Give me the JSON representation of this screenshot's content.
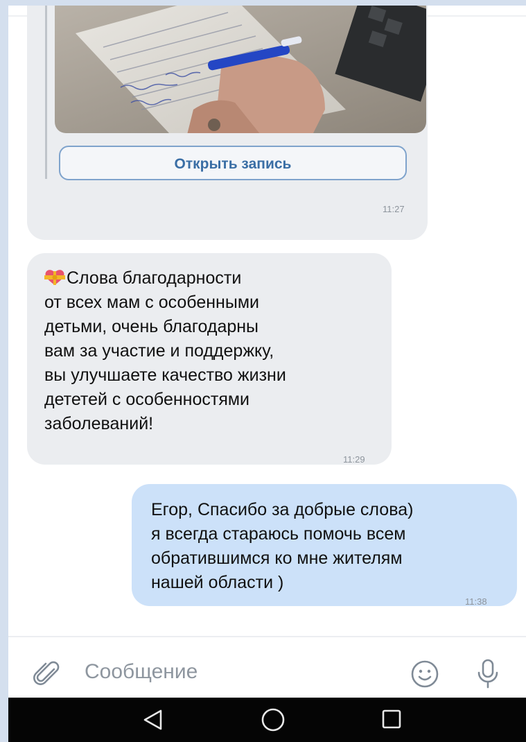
{
  "chat": {
    "link_card": {
      "open_button_label": "Открыть запись",
      "time": "11:27"
    },
    "incoming": {
      "emoji": "heart-with-bow-icon",
      "text": "Слова благодарности\nот всех мам с особенными\nдетьми, очень благодарны\nвам за участие  и поддержку,\nвы улучшаете качество жизни\nдететей с особенностями\nзаболеваний!",
      "time": "11:29"
    },
    "outgoing": {
      "text": "Егор, Спасибо за добрые слова)\nя всегда стараюсь помочь всем\nобратившимся ко мне жителям\nнашей области )",
      "time": "11:38"
    }
  },
  "input": {
    "placeholder": "Сообщение",
    "icons": [
      "paperclip-icon",
      "smile-icon",
      "microphone-icon"
    ]
  },
  "navigation": {
    "icons": [
      "back-triangle-icon",
      "home-circle-icon",
      "recent-square-icon"
    ]
  },
  "colors": {
    "incoming_bubble": "#ebedf0",
    "outgoing_bubble": "#cce1f9",
    "button_text": "#3a6ea5",
    "nav_bar": "#050505"
  }
}
